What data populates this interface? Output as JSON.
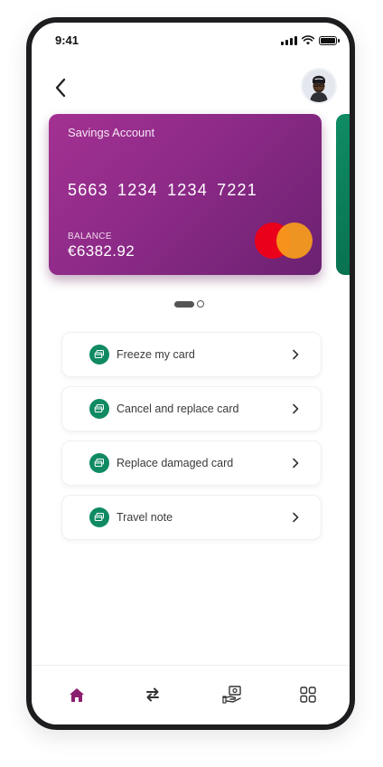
{
  "status_bar": {
    "time": "9:41"
  },
  "header": {
    "back_icon": "chevron-left-icon",
    "avatar_icon": "user-avatar"
  },
  "cards": [
    {
      "name": "Savings Account",
      "number": "5663 1234 1234 7221",
      "balance_label": "BALANCE",
      "balance": "€6382.92",
      "network": "mastercard",
      "color": "#9a2e8f"
    },
    {
      "color": "#0c7d59"
    }
  ],
  "pagination": {
    "total": 2,
    "active": 1
  },
  "actions": [
    {
      "label": "Freeze my card",
      "icon": "card-icon"
    },
    {
      "label": "Cancel and replace card",
      "icon": "card-icon"
    },
    {
      "label": "Replace damaged card",
      "icon": "card-icon"
    },
    {
      "label": "Travel note",
      "icon": "card-icon"
    }
  ],
  "bottom_nav": [
    {
      "icon": "home-icon",
      "active": true
    },
    {
      "icon": "transfer-icon",
      "active": false
    },
    {
      "icon": "payment-hand-icon",
      "active": false
    },
    {
      "icon": "grid-icon",
      "active": false
    }
  ],
  "colors": {
    "accent": "#8c1f6f",
    "action_icon": "#0f8a63",
    "card_primary": "#9a2e8f",
    "card_secondary": "#0c7d59"
  }
}
